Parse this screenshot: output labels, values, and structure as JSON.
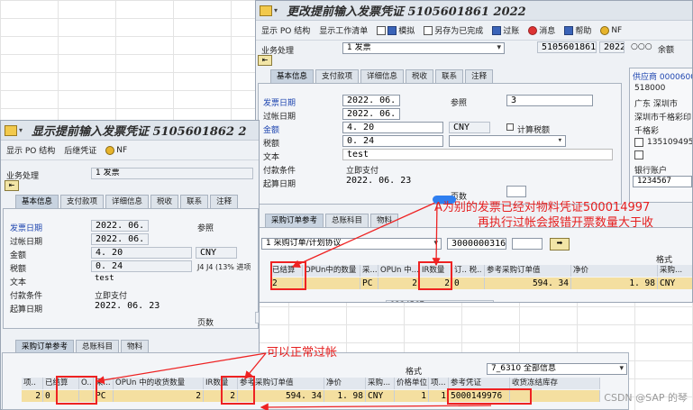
{
  "win_back": {
    "title": "更改提前输入发票凭证 5105601861 2022",
    "toolbar": [
      "显示 PO 结构",
      "显示工作清单",
      "模拟",
      "另存为已完成",
      "过账",
      "消息",
      "帮助",
      "NF"
    ],
    "business_label": "业务处理",
    "business_value": "1 发票",
    "doc_number": "5105601861",
    "year": "2022",
    "balance_label": "余额",
    "tabs": [
      "基本信息",
      "支付款项",
      "详细信息",
      "税收",
      "联系",
      "注释"
    ],
    "fields": {
      "invoice_date_label": "发票日期",
      "invoice_date": "2022. 06. 23",
      "posting_date_label": "过帐日期",
      "posting_date": "2022. 06. 23",
      "amount_label": "金额",
      "amount": "4. 20",
      "currency": "CNY",
      "tax_label": "税额",
      "tax": "0. 24",
      "text_label": "文本",
      "text": "test",
      "pay_terms_label": "付款条件",
      "pay_terms": "立即支付",
      "baseline_label": "起算日期",
      "baseline": "2022. 06. 23",
      "ref_label": "参照",
      "ref_value": "3",
      "calc_tax_label": "计算税额",
      "pages_label": "页数"
    },
    "vendor": {
      "header": "供应商 00006000",
      "postcode": "518000",
      "city": "广东  深圳市",
      "street": "深圳市千格彩印",
      "name": "千格彩",
      "phone": "13510949508",
      "bank_label": "银行账户",
      "bank": "1234567"
    },
    "po_tabs": [
      "采购订单参考",
      "总账科目",
      "物料"
    ],
    "po_ref_select": "1 采购订单/计划协议",
    "po_number": "3000000316",
    "format_label": "格式",
    "table_headers": [
      "已结算",
      "OPUn中的数量",
      "采...",
      "OPUn 中...",
      "IR数量",
      "订.. 税.. 将",
      "参考采购订单值",
      "净价",
      "采购..."
    ],
    "table_row": [
      "2",
      "",
      "PC",
      "2",
      "2",
      "0",
      "594. 34",
      "1. 98",
      "CNY"
    ],
    "extra_value": "1234567"
  },
  "win_front": {
    "title": "显示提前输入发票凭证 5105601862 2",
    "toolbar": [
      "显示 PO 结构",
      "后继凭证",
      "NF"
    ],
    "business_label": "业务处理",
    "business_value": "1 发票",
    "tabs": [
      "基本信息",
      "支付款项",
      "详细信息",
      "税收",
      "联系",
      "注释"
    ],
    "fields": {
      "invoice_date_label": "发票日期",
      "invoice_date": "2022. 06. 23",
      "posting_date_label": "过帐日期",
      "posting_date": "2022. 06. 23",
      "amount_label": "金额",
      "amount": "4. 20",
      "currency": "CNY",
      "tax_label": "税额",
      "tax": "0. 24",
      "tax_code": "J4 J4 (13% 进项",
      "text_label": "文本",
      "text": "test",
      "pay_terms_label": "付款条件",
      "pay_terms": "立即支付",
      "baseline_label": "起算日期",
      "baseline": "2022. 06. 23",
      "ref_label": "参照",
      "pages_label": "页数",
      "pages_value": "0"
    },
    "po_tabs": [
      "采购订单参考",
      "总账科目",
      "物料"
    ],
    "format_label": "格式",
    "format_value": "7_6310 全部信息",
    "table_headers": [
      "项..",
      "已结算",
      "O..",
      "采...",
      "OPUn 中的收货数量",
      "IR数量",
      "参考采购订单值",
      "净价",
      "采购...",
      "价格单位",
      "项...",
      "参考凭证",
      "收货冻结库存"
    ],
    "table_row": [
      "2",
      "0",
      "",
      "PC",
      "2",
      "2",
      "594. 34",
      "1. 98",
      "CNY",
      "1",
      "1",
      "5000149976",
      ""
    ]
  },
  "annotations": {
    "top_note_line1": "A为别的发票已经对物料凭证500014997",
    "top_note_line2": "再执行过帐会报错开票数量大于收",
    "bottom_note": "可以正常过帐"
  },
  "watermark": "CSDN @SAP 的琴",
  "colors": {
    "annotation": "#e52020",
    "selected_row": "#f4dfa0",
    "link_blue": "#1f46b0"
  }
}
